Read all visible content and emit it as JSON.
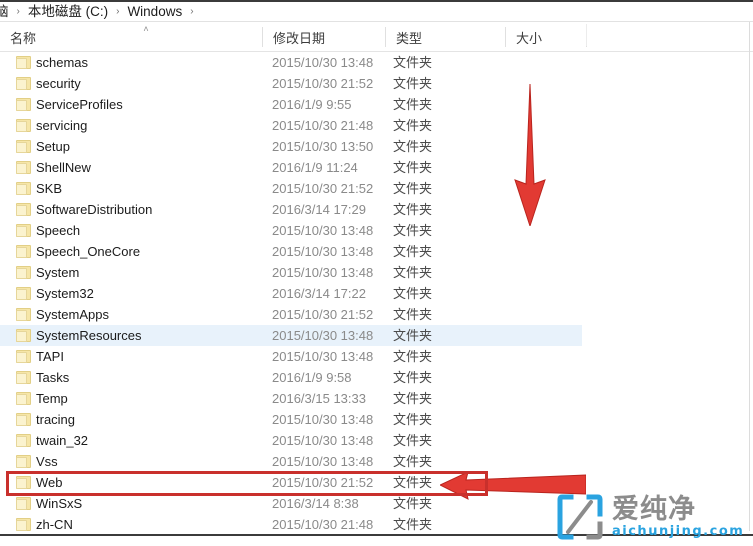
{
  "window": {
    "app": "file-explorer",
    "accent_selected": "#e8f2fb",
    "annotation_color": "#c9302c"
  },
  "breadcrumb": {
    "items": [
      {
        "label": "脑",
        "clipped": true
      },
      {
        "label": "本地磁盘 (C:)",
        "clipped": false
      },
      {
        "label": "Windows",
        "clipped": false
      }
    ],
    "separator": "›",
    "trailing_separator": "›"
  },
  "columns": [
    {
      "key": "name",
      "label": "名称",
      "sorted": true,
      "sort_direction": "asc",
      "sort_glyph": "˄"
    },
    {
      "key": "date",
      "label": "修改日期",
      "sorted": false
    },
    {
      "key": "type",
      "label": "类型",
      "sorted": false
    },
    {
      "key": "size",
      "label": "大小",
      "sorted": false
    }
  ],
  "rows": [
    {
      "icon": "folder-icon",
      "name": "schemas",
      "date": "2015/10/30 13:48",
      "type": "文件夹",
      "size": "",
      "selected": false
    },
    {
      "icon": "folder-icon",
      "name": "security",
      "date": "2015/10/30 21:52",
      "type": "文件夹",
      "size": "",
      "selected": false
    },
    {
      "icon": "folder-icon",
      "name": "ServiceProfiles",
      "date": "2016/1/9 9:55",
      "type": "文件夹",
      "size": "",
      "selected": false
    },
    {
      "icon": "folder-icon",
      "name": "servicing",
      "date": "2015/10/30 21:48",
      "type": "文件夹",
      "size": "",
      "selected": false
    },
    {
      "icon": "folder-icon",
      "name": "Setup",
      "date": "2015/10/30 13:50",
      "type": "文件夹",
      "size": "",
      "selected": false
    },
    {
      "icon": "folder-icon",
      "name": "ShellNew",
      "date": "2016/1/9 11:24",
      "type": "文件夹",
      "size": "",
      "selected": false
    },
    {
      "icon": "folder-icon",
      "name": "SKB",
      "date": "2015/10/30 21:52",
      "type": "文件夹",
      "size": "",
      "selected": false
    },
    {
      "icon": "folder-icon",
      "name": "SoftwareDistribution",
      "date": "2016/3/14 17:29",
      "type": "文件夹",
      "size": "",
      "selected": false
    },
    {
      "icon": "folder-icon",
      "name": "Speech",
      "date": "2015/10/30 13:48",
      "type": "文件夹",
      "size": "",
      "selected": false
    },
    {
      "icon": "folder-icon",
      "name": "Speech_OneCore",
      "date": "2015/10/30 13:48",
      "type": "文件夹",
      "size": "",
      "selected": false
    },
    {
      "icon": "folder-icon",
      "name": "System",
      "date": "2015/10/30 13:48",
      "type": "文件夹",
      "size": "",
      "selected": false
    },
    {
      "icon": "folder-icon",
      "name": "System32",
      "date": "2016/3/14 17:22",
      "type": "文件夹",
      "size": "",
      "selected": false
    },
    {
      "icon": "folder-icon",
      "name": "SystemApps",
      "date": "2015/10/30 21:52",
      "type": "文件夹",
      "size": "",
      "selected": false
    },
    {
      "icon": "folder-icon",
      "name": "SystemResources",
      "date": "2015/10/30 13:48",
      "type": "文件夹",
      "size": "",
      "selected": true
    },
    {
      "icon": "folder-icon",
      "name": "TAPI",
      "date": "2015/10/30 13:48",
      "type": "文件夹",
      "size": "",
      "selected": false
    },
    {
      "icon": "folder-icon",
      "name": "Tasks",
      "date": "2016/1/9 9:58",
      "type": "文件夹",
      "size": "",
      "selected": false
    },
    {
      "icon": "folder-icon",
      "name": "Temp",
      "date": "2016/3/15 13:33",
      "type": "文件夹",
      "size": "",
      "selected": false
    },
    {
      "icon": "folder-icon",
      "name": "tracing",
      "date": "2015/10/30 13:48",
      "type": "文件夹",
      "size": "",
      "selected": false
    },
    {
      "icon": "folder-icon",
      "name": "twain_32",
      "date": "2015/10/30 13:48",
      "type": "文件夹",
      "size": "",
      "selected": false
    },
    {
      "icon": "folder-icon",
      "name": "Vss",
      "date": "2015/10/30 13:48",
      "type": "文件夹",
      "size": "",
      "selected": false
    },
    {
      "icon": "folder-icon",
      "name": "Web",
      "date": "2015/10/30 21:52",
      "type": "文件夹",
      "size": "",
      "selected": false
    },
    {
      "icon": "folder-icon",
      "name": "WinSxS",
      "date": "2016/3/14 8:38",
      "type": "文件夹",
      "size": "",
      "selected": false
    },
    {
      "icon": "folder-icon",
      "name": "zh-CN",
      "date": "2015/10/30 21:48",
      "type": "文件夹",
      "size": "",
      "selected": false
    }
  ],
  "annotations": [
    {
      "kind": "arrow",
      "direction": "down",
      "target": "list-middle"
    },
    {
      "kind": "arrow",
      "direction": "left",
      "target": "row-web"
    },
    {
      "kind": "rectangle",
      "target": "row-web"
    }
  ],
  "watermark": {
    "mark": "aichunjing-logo-icon",
    "cn_text": "爱纯净",
    "url_text": "aichunjing.com",
    "mark_color": "#2aa3e0",
    "cn_color": "#8c8c8c"
  }
}
